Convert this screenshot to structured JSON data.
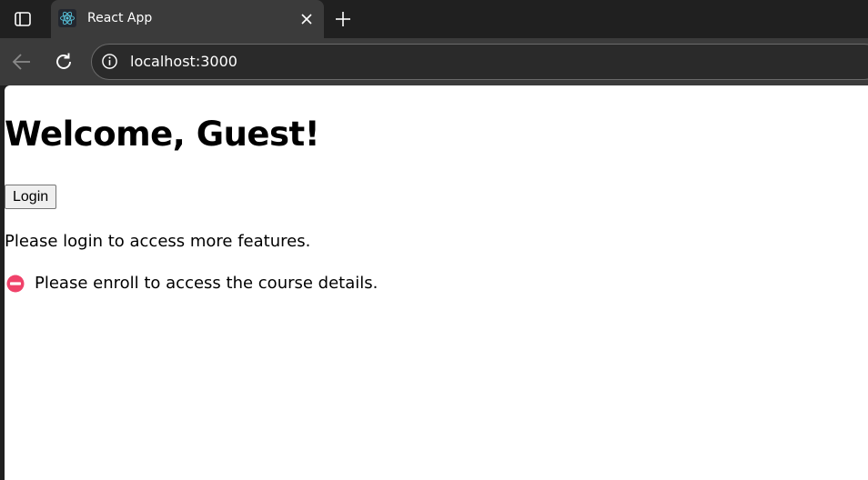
{
  "browser": {
    "tab": {
      "title": "React App",
      "favicon": "react-logo-icon"
    },
    "address_bar": {
      "url": "localhost:3000",
      "site_info_icon": "info-icon"
    },
    "colors": {
      "chrome_dark": "#202020",
      "toolbar": "#3b3b3b",
      "react_cyan": "#58c4dc"
    }
  },
  "page": {
    "heading": "Welcome, Guest!",
    "login_button_label": "Login",
    "login_prompt": "Please login to access more features.",
    "enroll_notice": {
      "icon": "no-entry-icon",
      "text": "Please enroll to access the course details.",
      "icon_color": "#f0426a"
    }
  }
}
